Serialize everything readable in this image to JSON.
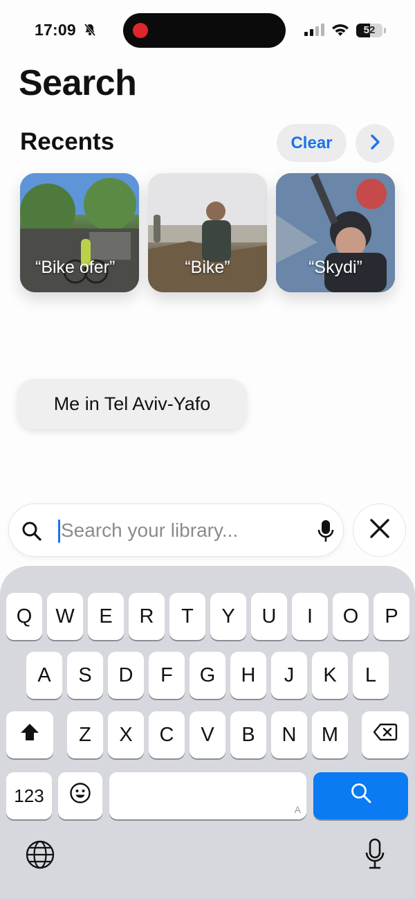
{
  "status_bar": {
    "time": "17:09",
    "battery": "52",
    "battery_level": 0.52,
    "recording": true
  },
  "page_title": "Search",
  "recents": {
    "title": "Recents",
    "clear_label": "Clear",
    "items": [
      {
        "label": "“Bike ofer”"
      },
      {
        "label": "“Bike”"
      },
      {
        "label": "“Skydi”"
      }
    ]
  },
  "suggestion": "Me in Tel Aviv-Yafo",
  "search": {
    "placeholder": "Search your library...",
    "value": ""
  },
  "keyboard": {
    "row1": [
      "Q",
      "W",
      "E",
      "R",
      "T",
      "Y",
      "U",
      "I",
      "O",
      "P"
    ],
    "row2": [
      "A",
      "S",
      "D",
      "F",
      "G",
      "H",
      "J",
      "K",
      "L"
    ],
    "row3": [
      "Z",
      "X",
      "C",
      "V",
      "B",
      "N",
      "M"
    ],
    "numbers_label": "123",
    "space_hint": "A"
  },
  "colors": {
    "accent": "#1a73e8",
    "search_key": "#0a7bf2",
    "record_dot": "#e0262b",
    "keyboard_bg": "#d6d8de"
  }
}
